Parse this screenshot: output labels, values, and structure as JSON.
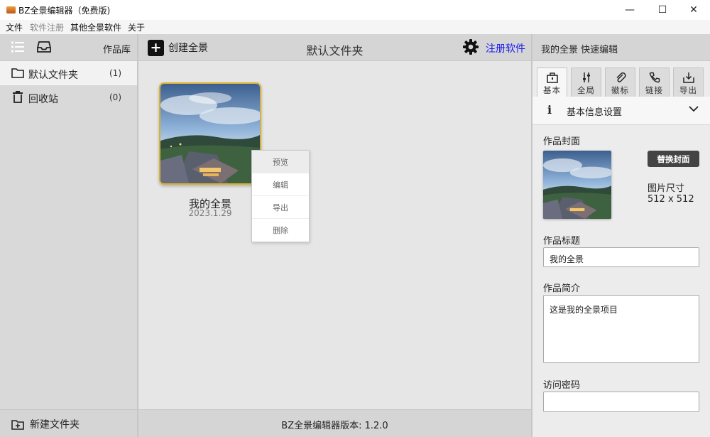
{
  "window": {
    "title": "BZ全景编辑器（免费版)",
    "minimize": "—",
    "maximize": "☐",
    "close": "✕"
  },
  "menu": [
    "文件",
    "软件注册",
    "其他全景软件",
    "关于"
  ],
  "left": {
    "header_title": "作品库",
    "folders": [
      {
        "label": "默认文件夹",
        "count": "(1)"
      },
      {
        "label": "回收站",
        "count": "(0)"
      }
    ],
    "new_folder_label": "新建文件夹"
  },
  "center": {
    "create_label": "创建全景",
    "title": "默认文件夹",
    "register_label": "注册软件",
    "project": {
      "name": "我的全景",
      "date": "2023.1.29"
    },
    "context_menu": [
      "预览",
      "编辑",
      "导出",
      "删除"
    ],
    "footer": "BZ全景编辑器版本: 1.2.0"
  },
  "right": {
    "header_title": "我的全景 快速编辑",
    "tabs": [
      "基本",
      "全局",
      "徽标",
      "链接",
      "导出"
    ],
    "section_title": "基本信息设置",
    "cover_label": "作品封面",
    "replace_button": "替换封面",
    "size_label": "图片尺寸",
    "size_value": "512 x 512",
    "title_label": "作品标题",
    "title_value": "我的全景",
    "desc_label": "作品简介",
    "desc_value": "这是我的全景项目",
    "password_label": "访问密码",
    "password_value": ""
  },
  "colors": {
    "link": "#1a1aee",
    "thumb_border": "#d9b233",
    "button_dark": "#444444"
  }
}
